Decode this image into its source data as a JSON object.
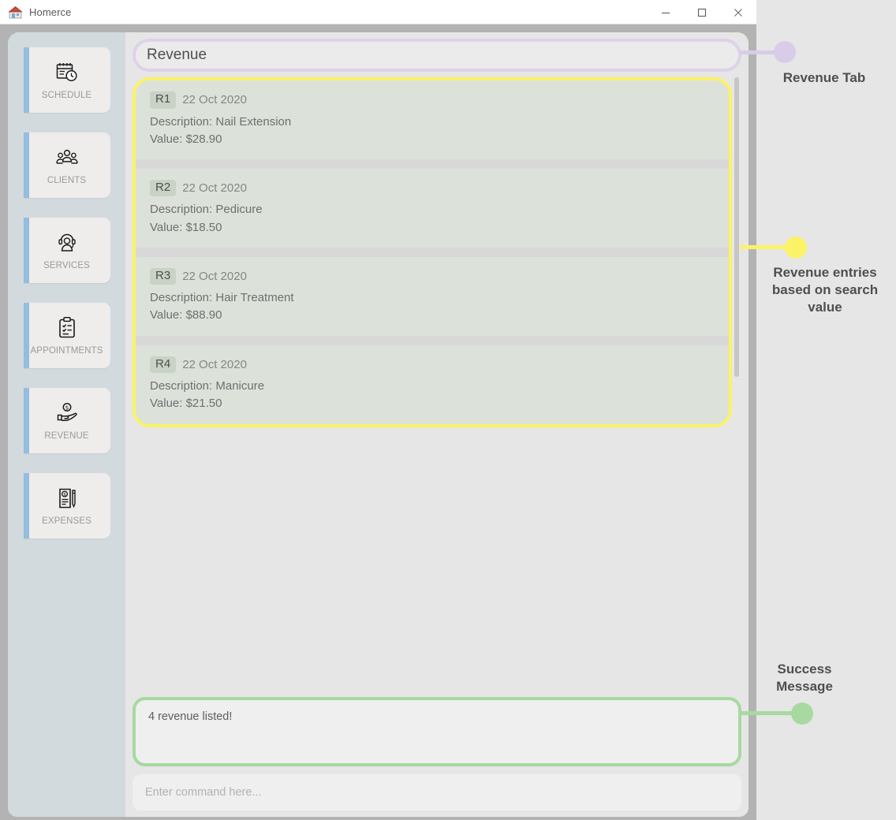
{
  "window": {
    "title": "Homerce",
    "icon": "house-app-icon",
    "controls": [
      {
        "name": "minimize",
        "glyph": "minimize-icon"
      },
      {
        "name": "maximize",
        "glyph": "maximize-icon"
      },
      {
        "name": "close",
        "glyph": "close-icon"
      }
    ]
  },
  "sidebar": {
    "items": [
      {
        "label": "SCHEDULE",
        "icon": "calendar-clock-icon"
      },
      {
        "label": "CLIENTS",
        "icon": "people-group-icon"
      },
      {
        "label": "SERVICES",
        "icon": "headset-person-icon"
      },
      {
        "label": "APPOINTMENTS",
        "icon": "clipboard-check-icon"
      },
      {
        "label": "REVENUE",
        "icon": "hand-coin-icon"
      },
      {
        "label": "EXPENSES",
        "icon": "receipt-pen-icon"
      }
    ]
  },
  "main": {
    "tab_title": "Revenue",
    "entries": [
      {
        "id": "R1",
        "date": "22 Oct 2020",
        "description": "Description: Nail Extension",
        "value": "Value: $28.90"
      },
      {
        "id": "R2",
        "date": "22 Oct 2020",
        "description": "Description: Pedicure",
        "value": "Value: $18.50"
      },
      {
        "id": "R3",
        "date": "22 Oct 2020",
        "description": "Description: Hair Treatment",
        "value": "Value: $88.90"
      },
      {
        "id": "R4",
        "date": "22 Oct 2020",
        "description": "Description: Manicure",
        "value": "Value: $21.50"
      }
    ],
    "result_message": "4 revenue listed!",
    "command_placeholder": "Enter command here..."
  },
  "annotations": [
    {
      "label": "Revenue Tab",
      "color": "#d8cce8"
    },
    {
      "label": "Revenue entries\nbased on search\nvalue",
      "color": "#fcf266"
    },
    {
      "label": "Success\nMessage",
      "color": "#a7d9a0"
    }
  ],
  "colors": {
    "sidebar_bg": "#d2dade",
    "nav_accent": "#95bdde",
    "entry_bg": "#dce2da",
    "badge_bg": "#c8d2c5",
    "tab_border": "#ddd2e8",
    "list_border": "#fcf266",
    "result_border": "#a7d9a0",
    "page_bg": "#e6e6e6"
  }
}
